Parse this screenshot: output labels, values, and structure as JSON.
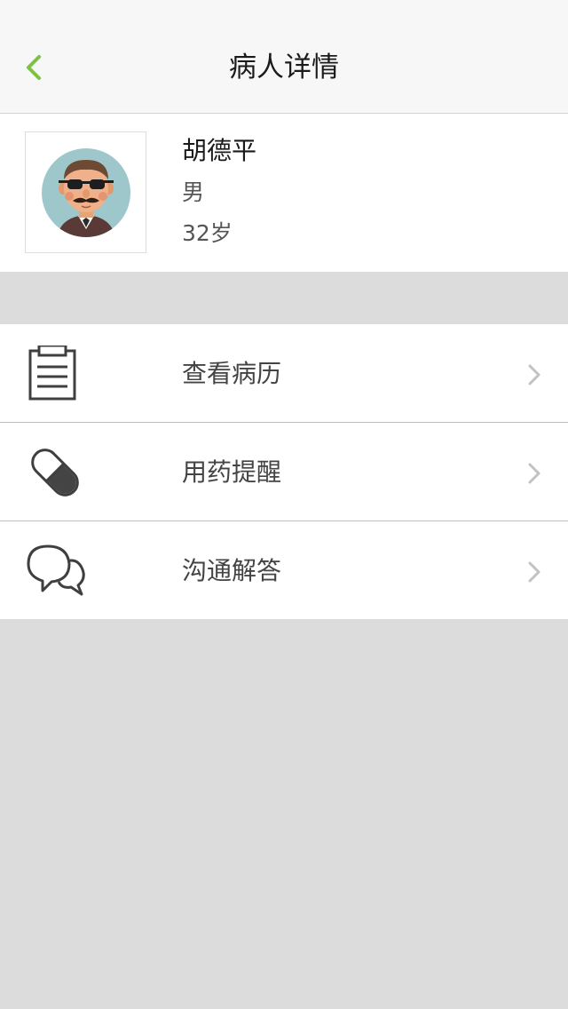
{
  "header": {
    "title": "病人详情",
    "back_icon": "chevron-left-icon",
    "accent_color": "#7dc242"
  },
  "patient": {
    "name": "胡德平",
    "gender": "男",
    "age": "32岁",
    "avatar_icon": "avatar-icon"
  },
  "menu": {
    "items": [
      {
        "label": "查看病历",
        "icon": "clipboard-icon"
      },
      {
        "label": "用药提醒",
        "icon": "pill-icon"
      },
      {
        "label": "沟通解答",
        "icon": "chat-bubbles-icon"
      }
    ]
  },
  "colors": {
    "background": "#dcdcdc",
    "navbar": "#f7f7f7",
    "card": "#ffffff"
  }
}
